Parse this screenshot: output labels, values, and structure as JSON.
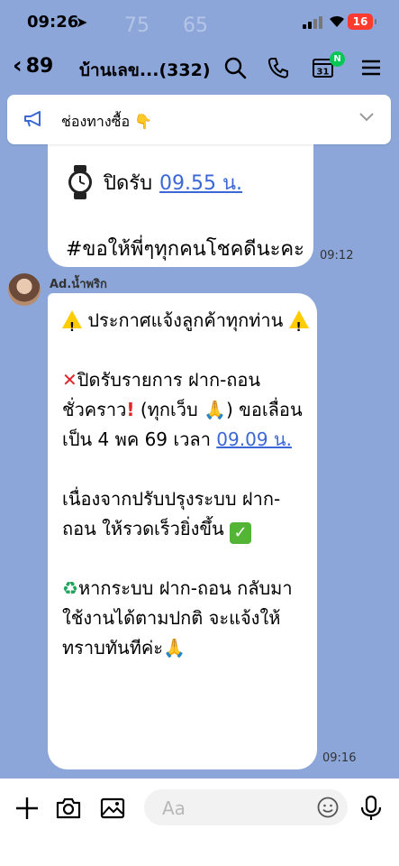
{
  "status_bar": {
    "time": "09:26",
    "battery": "16",
    "background_numbers": [
      "75",
      "65"
    ]
  },
  "header": {
    "back_count": "89",
    "title": "บ้านเลข...(332)",
    "calendar_day": "31",
    "calendar_badge": "N"
  },
  "banner": {
    "text": "ช่องทางซื้อ 👇"
  },
  "messages": [
    {
      "partial_line1_prefix": "ปิดรับ ",
      "partial_line1_link": "09.55 น.",
      "partial_line2": "#ขอให้พี่ๆทุกคนโชคดีนะคะ",
      "time": "09:12"
    },
    {
      "sender": "Ad.น้ำพริก",
      "p1": "ประกาศแจ้งลูกค้าทุกท่าน",
      "p2_a": "ปิดรับรายการ ฝาก-ถอน ชั่วคราว",
      "p2_b": " (ทุกเว็บ ",
      "p2_c": ") ขอเลื่อนเป็น 4 พค 69 เวลา ",
      "p2_link": "09.09 น.",
      "p3": "เนื่องจากปรับปรุงระบบ ฝาก-ถอน ให้รวดเร็วยิ่งขึ้น",
      "p4": "หากระบบ ฝาก-ถอน กลับมาใช้งานได้ตามปกติ จะแจ้งให้ทราบทันทีค่ะ",
      "time": "09:16"
    }
  ],
  "input": {
    "placeholder": "Aa"
  },
  "colors": {
    "chat_bg": "#8ca6d9",
    "link": "#3b68d6",
    "badge": "#06c755",
    "battery": "#ff3b30"
  }
}
